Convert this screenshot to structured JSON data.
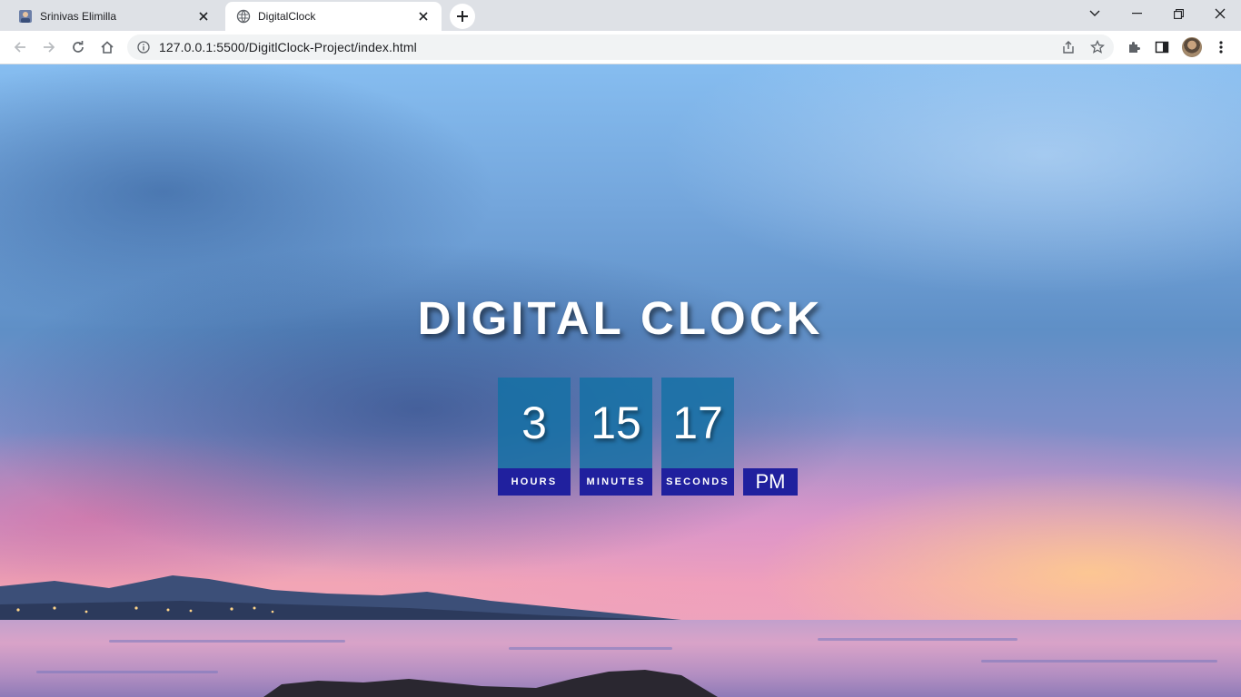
{
  "browser": {
    "tabs": [
      {
        "title": "Srinivas Elimilla",
        "favicon": "profile-photo-icon",
        "active": false
      },
      {
        "title": "DigitalClock",
        "favicon": "globe-icon",
        "active": true
      }
    ],
    "address_bar": {
      "url": "127.0.0.1:5500/DigitlClock-Project/index.html"
    }
  },
  "page": {
    "title": "DIGITAL CLOCK",
    "clock": {
      "hours": "3",
      "minutes": "15",
      "seconds": "17",
      "hours_label": "HOURS",
      "minutes_label": "MINUTES",
      "seconds_label": "SECONDS",
      "period": "PM"
    }
  },
  "colors": {
    "digit_box": "#1270a5",
    "label_box": "#20209e",
    "title_text": "#ffffff"
  }
}
